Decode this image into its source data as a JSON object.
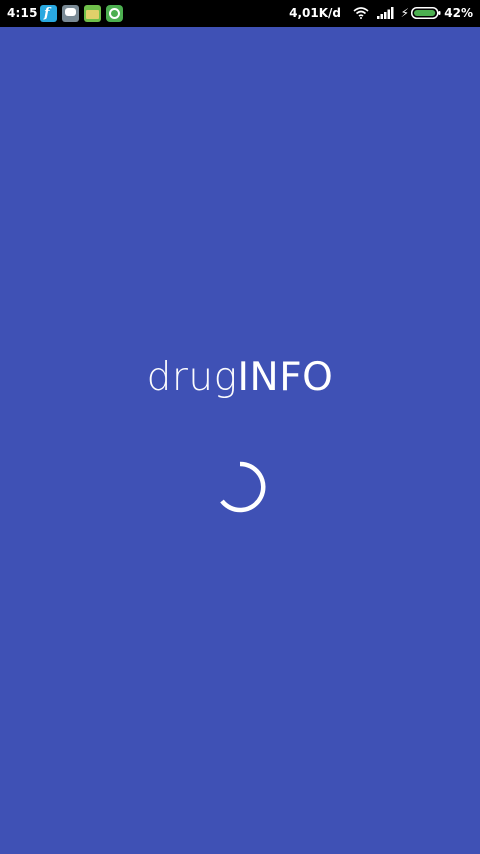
{
  "status_bar": {
    "time": "4:15",
    "notification_icons": [
      "app-notification-icon",
      "message-notification-icon",
      "download-notification-icon",
      "sync-notification-icon"
    ],
    "network_speed": "4,01K/d",
    "battery_percent": "42%",
    "battery_level": 0.42,
    "charging": true,
    "icons": [
      "wifi-icon",
      "signal-icon",
      "charging-icon",
      "battery-icon"
    ]
  },
  "splash": {
    "title_light": "drug",
    "title_bold": "INFO",
    "loading": true
  },
  "colors": {
    "background": "#3F51B5",
    "status_bar": "#000000",
    "text": "#FFFFFF",
    "battery_fill": "#4CAF50"
  }
}
